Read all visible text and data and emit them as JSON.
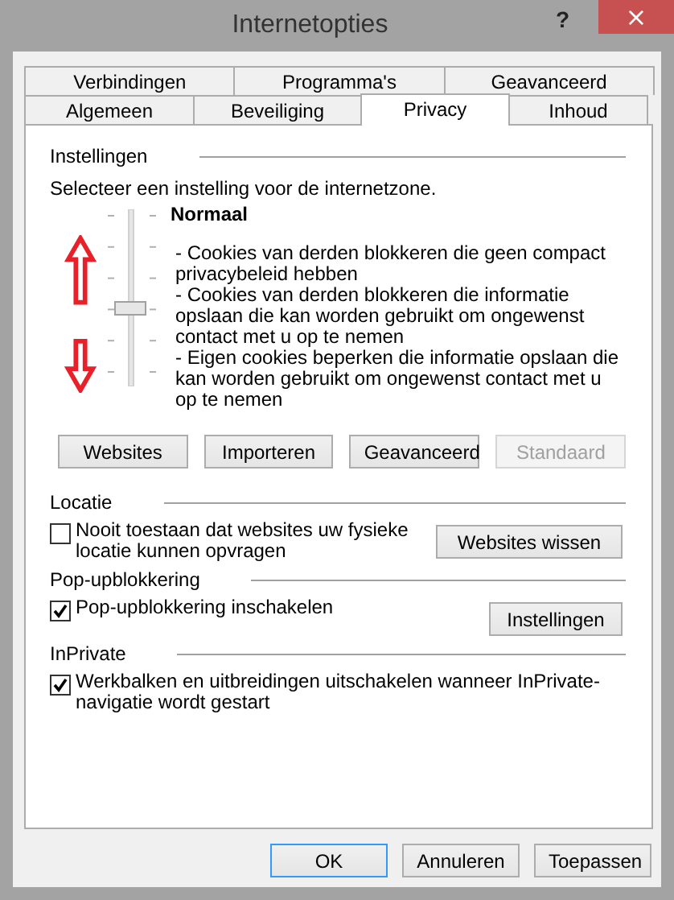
{
  "window": {
    "title": "Internetopties",
    "help": "?",
    "close": "×"
  },
  "tabs": [
    [
      {
        "label": "Verbindingen",
        "selected": false
      },
      {
        "label": "Programma's",
        "selected": false
      },
      {
        "label": "Geavanceerd",
        "selected": false
      }
    ],
    [
      {
        "label": "Algemeen",
        "selected": false
      },
      {
        "label": "Beveiliging",
        "selected": false
      },
      {
        "label": "Privacy",
        "selected": true
      },
      {
        "label": "Inhoud",
        "selected": false
      }
    ]
  ],
  "settings": {
    "heading": "Instellingen",
    "intro": "Selecteer een instelling voor de internetzone.",
    "slider": {
      "level": 0.4
    },
    "level_name": "Normaal",
    "description": [
      "- Cookies van derden blokkeren die geen compact privacybeleid hebben",
      "- Cookies van derden blokkeren die informatie opslaan die kan worden gebruikt om ongewenst contact met u op te nemen",
      "- Eigen cookies beperken die informatie opslaan die kan worden gebruikt om ongewenst contact met u op te nemen"
    ],
    "buttons": [
      {
        "label": "Websites",
        "disabled": false
      },
      {
        "label": "Importeren",
        "disabled": false
      },
      {
        "label": "Geavanceerd",
        "disabled": false
      },
      {
        "label": "Standaard",
        "disabled": true
      }
    ]
  },
  "sections": [
    {
      "heading": "Locatie",
      "option": {
        "label": "Nooit toestaan dat websites uw fysieke locatie kunnen opvragen",
        "checked": false
      },
      "button": {
        "label": "Websites wissen"
      }
    },
    {
      "heading": "Pop-upblokkering",
      "option": {
        "label": "Pop-upblokkering inschakelen",
        "checked": true
      },
      "button": {
        "label": "Instellingen"
      }
    },
    {
      "heading": "InPrivate",
      "option": {
        "label": "Werkbalken en uitbreidingen uitschakelen wanneer InPrivate-navigatie wordt gestart",
        "checked": true
      }
    }
  ],
  "dialog_buttons": [
    {
      "label": "OK",
      "default": true
    },
    {
      "label": "Annuleren",
      "default": false
    },
    {
      "label": "Toepassen",
      "default": false
    }
  ]
}
